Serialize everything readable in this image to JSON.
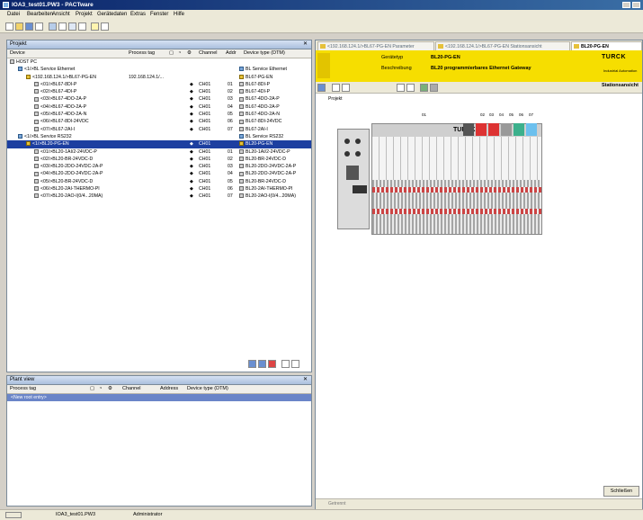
{
  "window": {
    "title": "IOA3_test01.PW3 - PACTware"
  },
  "menu": [
    "Datei",
    "Bearbeiten",
    "Ansicht",
    "Projekt",
    "Gerätedaten",
    "Extras",
    "Fenster",
    "Hilfe"
  ],
  "project_panel": {
    "title": "Projekt",
    "columns": [
      "Device",
      "Process tag",
      "",
      "",
      "",
      "Channel",
      "Addr",
      "Device type (DTM)"
    ],
    "root_label": "HOST PC",
    "rows": [
      {
        "device": "<1/>BL Service Ethernet",
        "tag": "",
        "ch": "",
        "addr": "",
        "type": "BL Service Ethernet",
        "indent": 1,
        "kind": "net"
      },
      {
        "device": "<192.168.124.1/>BL67-PG-EN",
        "tag": "192.168.124.1/...",
        "ch": "",
        "addr": "",
        "type": "BL67-PG-EN",
        "indent": 2,
        "kind": "gw"
      },
      {
        "device": "<01/>BL67-8DI-P",
        "tag": "",
        "ch": "CH01",
        "addr": "01",
        "type": "BL67-8DI-P",
        "indent": 3,
        "kind": "mod"
      },
      {
        "device": "<02/>BL67-4DI-P",
        "tag": "",
        "ch": "CH01",
        "addr": "02",
        "type": "BL67-4DI-P",
        "indent": 3,
        "kind": "mod"
      },
      {
        "device": "<03/>BL67-4DO-2A-P",
        "tag": "",
        "ch": "CH01",
        "addr": "03",
        "type": "BL67-4DO-2A-P",
        "indent": 3,
        "kind": "mod"
      },
      {
        "device": "<04/>BL67-4DO-2A-P",
        "tag": "",
        "ch": "CH01",
        "addr": "04",
        "type": "BL67-4DO-2A-P",
        "indent": 3,
        "kind": "mod"
      },
      {
        "device": "<05/>BL67-4DO-2A-N",
        "tag": "",
        "ch": "CH01",
        "addr": "05",
        "type": "BL67-4DO-2A-N",
        "indent": 3,
        "kind": "mod"
      },
      {
        "device": "<06/>BL67-8DI-24VDC",
        "tag": "",
        "ch": "CH01",
        "addr": "06",
        "type": "BL67-8DI-24VDC",
        "indent": 3,
        "kind": "mod"
      },
      {
        "device": "<07/>BL67-2AI-I",
        "tag": "",
        "ch": "CH01",
        "addr": "07",
        "type": "BL67-2AI-I",
        "indent": 3,
        "kind": "mod"
      },
      {
        "device": "<1/>BL Service RS232",
        "tag": "",
        "ch": "",
        "addr": "",
        "type": "BL Service RS232",
        "indent": 1,
        "kind": "net"
      },
      {
        "device": "<1/>BL20-PG-EN",
        "tag": "",
        "ch": "CH01",
        "addr": "",
        "type": "BL20-PG-EN",
        "indent": 2,
        "kind": "gw",
        "selected": true
      },
      {
        "device": "<01/>BL20-1AI/2-24VDC-P",
        "tag": "",
        "ch": "CH01",
        "addr": "01",
        "type": "BL20-1AI/2-24VDC-P",
        "indent": 3,
        "kind": "mod"
      },
      {
        "device": "<02/>BL20-BR-24VDC-D",
        "tag": "",
        "ch": "CH01",
        "addr": "02",
        "type": "BL20-BR-24VDC-D",
        "indent": 3,
        "kind": "mod"
      },
      {
        "device": "<03/>BL20-2DO-24VDC-2A-P",
        "tag": "",
        "ch": "CH01",
        "addr": "03",
        "type": "BL20-2DO-24VDC-2A-P",
        "indent": 3,
        "kind": "mod"
      },
      {
        "device": "<04/>BL20-2DO-24VDC-2A-P",
        "tag": "",
        "ch": "CH01",
        "addr": "04",
        "type": "BL20-2DO-24VDC-2A-P",
        "indent": 3,
        "kind": "mod"
      },
      {
        "device": "<05/>BL20-BR-24VDC-D",
        "tag": "",
        "ch": "CH01",
        "addr": "05",
        "type": "BL20-BR-24VDC-D",
        "indent": 3,
        "kind": "mod"
      },
      {
        "device": "<06/>BL20-2AI-THERMO-PI",
        "tag": "",
        "ch": "CH01",
        "addr": "06",
        "type": "BL20-2AI-THERMO-PI",
        "indent": 3,
        "kind": "mod"
      },
      {
        "device": "<07/>BL20-2AO-I(0/4...20MA)",
        "tag": "",
        "ch": "CH01",
        "addr": "07",
        "type": "BL20-2AO-I(0/4...20MA)",
        "indent": 3,
        "kind": "mod"
      }
    ]
  },
  "plant_panel": {
    "title": "Plant view",
    "columns": [
      "Process tag",
      "",
      "",
      "",
      "Channel",
      "Address",
      "Device type (DTM)"
    ],
    "new_entry": "<New root entry>"
  },
  "right": {
    "tabs": [
      "<192.168.124.1/>BL67-PG-EN Parameter",
      "<192.168.124.1/>BL67-PG-EN Stationsansicht",
      "BL20-PG-EN"
    ],
    "header": {
      "row1_label": "Gerätetyp",
      "row1_value": "BL20-PG-EN",
      "row2_label": "Beschreibung",
      "row2_value": "BL20 programmierbares Ethernet Gateway",
      "brand": "TURCK",
      "brand_sub": "Industrial Automation"
    },
    "view_label": "Stationsansicht",
    "project_label": "Projekt",
    "brand_on_device": "TURCK",
    "slot_numbers": [
      "01",
      "02",
      "03",
      "04",
      "05",
      "06",
      "07"
    ],
    "close_button": "Schließen",
    "status_left": "Getrennt"
  },
  "status": {
    "file": "IOA3_test01.PW3",
    "user": "Administrator"
  }
}
